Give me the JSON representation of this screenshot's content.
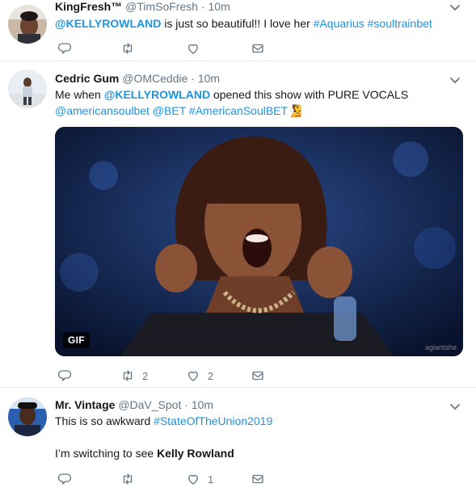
{
  "tweets": [
    {
      "name": "KingFresh™",
      "handle": "@TimSoFresh",
      "dot": "·",
      "time": "10m",
      "text_parts": {
        "mention": "@KELLYROWLAND",
        "plain": " is just so beautiful!! I love her ",
        "tag1": "#Aquarius",
        "space": " ",
        "tag2": "#soultrainbet"
      },
      "actions": {
        "reply_count": "",
        "retweet_count": "",
        "like_count": ""
      }
    },
    {
      "name": "Cedric Gum",
      "handle": "@OMCeddie",
      "dot": "·",
      "time": "10m",
      "text_parts": {
        "pre": "Me when ",
        "mention": "@KELLYROWLAND",
        "post": " opened this show with PURE VOCALS",
        "line2_mention1": "@americansoulbet",
        "line2_mention2": "@BET",
        "line2_tag": "#AmericanSoulBET",
        "emoji": "🧏"
      },
      "media": {
        "badge": "GIF",
        "watermark": "agiantshe"
      },
      "actions": {
        "reply_count": "",
        "retweet_count": "2",
        "like_count": "2"
      }
    },
    {
      "name": "Mr. Vintage",
      "handle": "@DaV_Spot",
      "dot": "·",
      "time": "10m",
      "text_parts": {
        "pre": "This is so awkward ",
        "tag": "#StateOfTheUnion2019",
        "line2_pre": "I’m switching to see ",
        "line2_bold": "Kelly Rowland"
      },
      "actions": {
        "reply_count": "",
        "retweet_count": "",
        "like_count": "1"
      }
    }
  ],
  "icons": {
    "reply": "reply-icon",
    "retweet": "retweet-icon",
    "like": "heart-icon",
    "dm": "envelope-icon",
    "caret": "chevron-down-icon"
  },
  "colors": {
    "link": "#1b95e0",
    "secondary": "#657786",
    "divider": "#e6ecf0"
  }
}
